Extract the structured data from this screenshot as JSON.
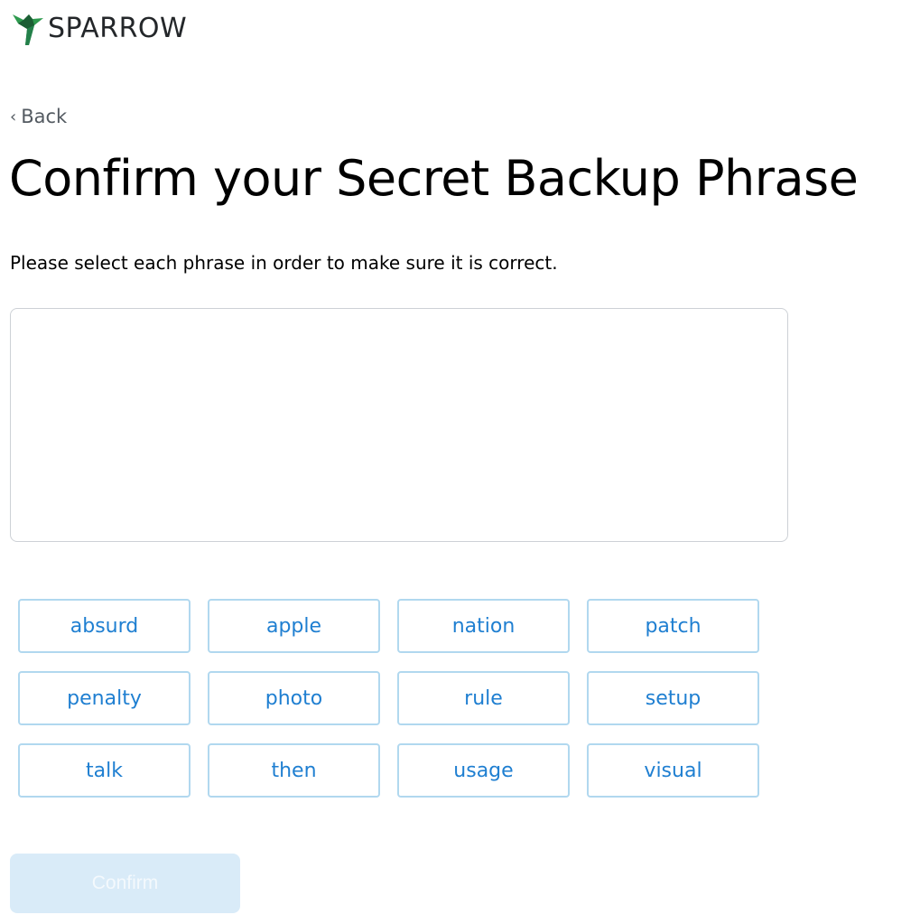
{
  "brand": {
    "name": "SPARROW",
    "logo_icon": "sparrow-bird-icon",
    "colors": {
      "logo_green": "#2e9a4e",
      "logo_dark": "#1b5e34"
    }
  },
  "nav": {
    "back_label": "Back",
    "back_icon": "chevron-left-icon"
  },
  "page": {
    "title": "Confirm your Secret Backup Phrase",
    "subtitle": "Please select each phrase in order to make sure it is correct."
  },
  "words": [
    "absurd",
    "apple",
    "nation",
    "patch",
    "penalty",
    "photo",
    "rule",
    "setup",
    "talk",
    "then",
    "usage",
    "visual"
  ],
  "confirm_button": {
    "label": "Confirm",
    "disabled": true
  },
  "colors": {
    "word_text": "#1f7fd1",
    "word_border": "#b1d8ef",
    "confirm_bg_disabled": "#d9ebf8"
  }
}
